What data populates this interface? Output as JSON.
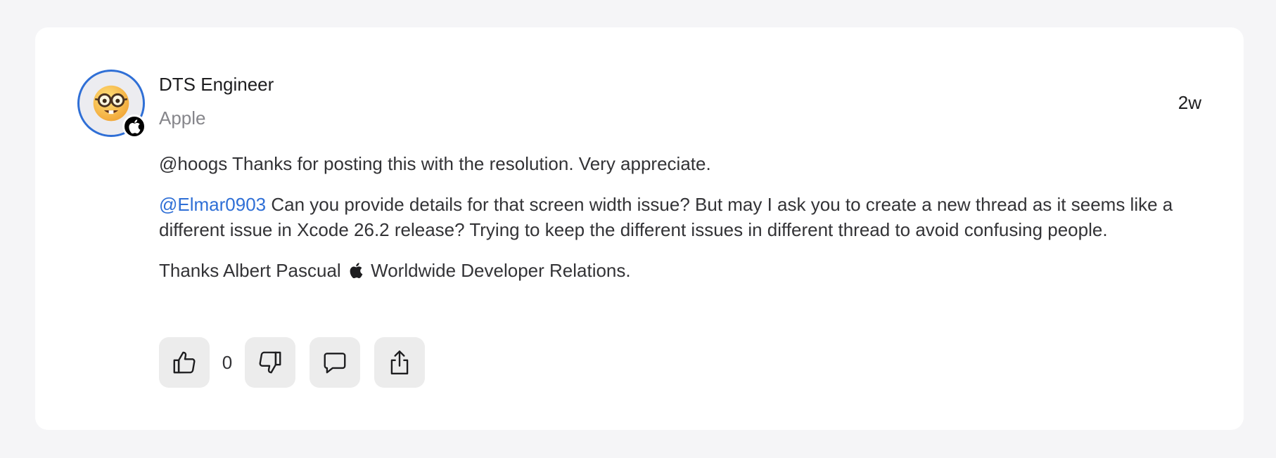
{
  "post": {
    "author": {
      "name": "DTS Engineer",
      "organization": "Apple",
      "avatar_icon": "nerd-face-emoji",
      "badge_icon": "apple-logo-icon",
      "avatar_ring_color": "#2f6fd6"
    },
    "time_ago": "2w",
    "paragraphs": {
      "p1": "@hoogs Thanks for posting this with the resolution. Very appreciate.",
      "p2_mention": "@Elmar0903",
      "p2_text": " Can you provide details for that screen width issue? But may I ask you to create a new thread as it seems like a different issue in Xcode 26.2 release? Trying to keep the different issues in different thread to avoid confusing people.",
      "p3_before": "Thanks Albert Pascual ",
      "p3_after": " Worldwide Developer Relations."
    },
    "actions": {
      "upvote_icon": "thumbs-up-icon",
      "vote_count": "0",
      "downvote_icon": "thumbs-down-icon",
      "reply_icon": "comment-icon",
      "share_icon": "share-icon"
    }
  },
  "colors": {
    "page_bg": "#f5f5f7",
    "card_bg": "#ffffff",
    "link": "#2f6fd6",
    "muted": "#86868b",
    "button_bg": "#ececec"
  }
}
